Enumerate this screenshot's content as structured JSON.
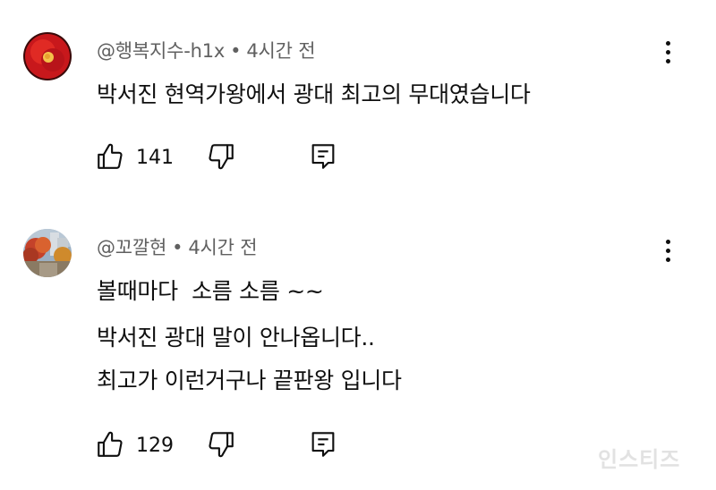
{
  "comments": [
    {
      "author": "@행복지수-h1x",
      "separator": "•",
      "time": "4시간 전",
      "lines": [
        "박서진 현역가왕에서 광대 최고의 무대였습니다"
      ],
      "likes": "141",
      "avatar_icon": "red-flower-avatar"
    },
    {
      "author": "@꼬깔현",
      "separator": "•",
      "time": "4시간 전",
      "lines": [
        "볼때마다  소름 소름 ~~",
        "박서진 광대 말이 안나옵니다..",
        "최고가 이런거구나 끝판왕 입니다"
      ],
      "likes": "129",
      "avatar_icon": "autumn-street-avatar"
    }
  ],
  "watermark": "인스티즈",
  "icons": {
    "like": "thumbs-up-icon",
    "dislike": "thumbs-down-icon",
    "reply": "reply-icon",
    "more": "more-vertical-icon"
  },
  "colors": {
    "text": "#0f0f0f",
    "meta": "#606060",
    "avatar1": "#d41f1f",
    "watermark": "#e2e2e2"
  }
}
